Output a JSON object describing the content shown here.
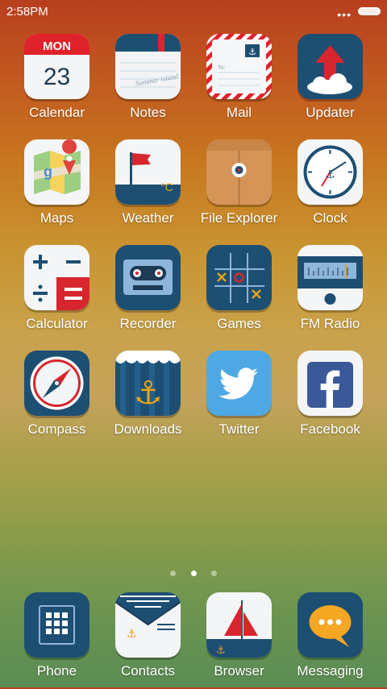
{
  "status": {
    "time": "2:58PM",
    "dots": "•••"
  },
  "apps": [
    {
      "label": "Calendar",
      "icon": "calendar-icon",
      "day": "MON",
      "date": "23"
    },
    {
      "label": "Notes",
      "icon": "notes-icon",
      "note_text": "Summer island"
    },
    {
      "label": "Mail",
      "icon": "mail-icon",
      "to_text": "To:"
    },
    {
      "label": "Updater",
      "icon": "updater-icon"
    },
    {
      "label": "Maps",
      "icon": "maps-icon"
    },
    {
      "label": "Weather",
      "icon": "weather-icon",
      "unit": "°C"
    },
    {
      "label": "File Explorer",
      "icon": "file-explorer-icon"
    },
    {
      "label": "Clock",
      "icon": "clock-icon"
    },
    {
      "label": "Calculator",
      "icon": "calculator-icon"
    },
    {
      "label": "Recorder",
      "icon": "recorder-icon"
    },
    {
      "label": "Games",
      "icon": "games-icon"
    },
    {
      "label": "FM Radio",
      "icon": "fm-radio-icon"
    },
    {
      "label": "Compass",
      "icon": "compass-icon"
    },
    {
      "label": "Downloads",
      "icon": "downloads-icon"
    },
    {
      "label": "Twitter",
      "icon": "twitter-icon"
    },
    {
      "label": "Facebook",
      "icon": "facebook-icon"
    }
  ],
  "pager": {
    "count": 3,
    "active": 1
  },
  "dock": [
    {
      "label": "Phone",
      "icon": "phone-icon"
    },
    {
      "label": "Contacts",
      "icon": "contacts-icon"
    },
    {
      "label": "Browser",
      "icon": "browser-icon"
    },
    {
      "label": "Messaging",
      "icon": "messaging-icon"
    }
  ]
}
